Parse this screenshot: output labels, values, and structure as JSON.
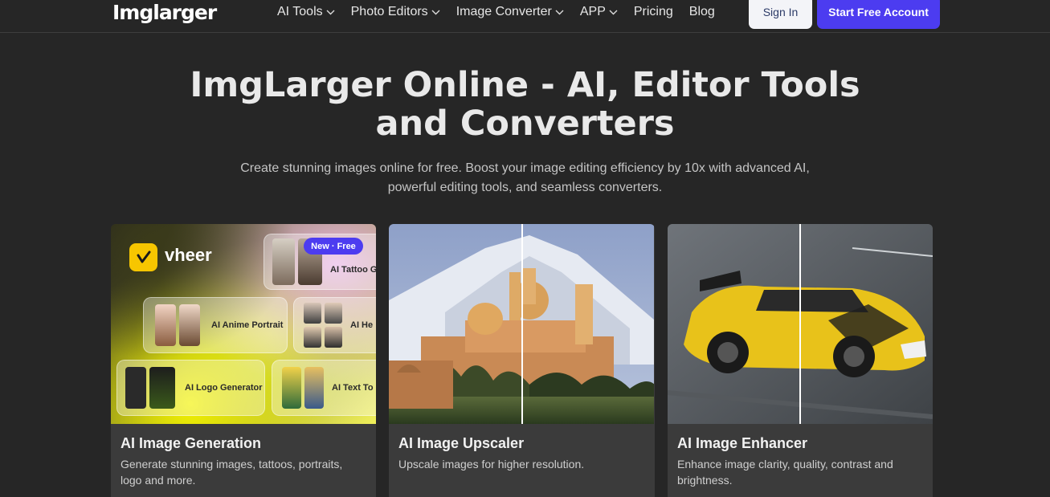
{
  "nav": {
    "logo": "Imglarger",
    "menu": [
      {
        "label": "AI Tools",
        "dropdown": true
      },
      {
        "label": "Photo Editors",
        "dropdown": true
      },
      {
        "label": "Image Converter",
        "dropdown": true
      },
      {
        "label": "APP",
        "dropdown": true
      },
      {
        "label": "Pricing",
        "dropdown": false
      },
      {
        "label": "Blog",
        "dropdown": false
      }
    ],
    "sign_in": "Sign In",
    "start_free": "Start Free Account"
  },
  "hero": {
    "title_line1": "ImgLarger Online - AI, Editor Tools",
    "title_line2": "and Converters",
    "subtitle_line1": "Create stunning images online for free. Boost your image editing efficiency by 10x with advanced AI,",
    "subtitle_line2": "powerful editing tools, and seamless converters."
  },
  "cards": [
    {
      "title": "AI Image Generation",
      "description": "Generate stunning images, tattoos, portraits, logo and more.",
      "image": {
        "brand": "vheer",
        "badge": "New · Free",
        "tiles": [
          "AI Tattoo Ge",
          "AI Anime Portrait",
          "AI He",
          "AI Logo Generator",
          "AI Text To I"
        ]
      }
    },
    {
      "title": "AI Image Upscaler",
      "description": "Upscale images for higher resolution."
    },
    {
      "title": "AI Image Enhancer",
      "description": "Enhance image clarity, quality, contrast and brightness."
    }
  ],
  "colors": {
    "background": "#262626",
    "accent": "#4c3cf0",
    "card": "#3b3b3b"
  }
}
